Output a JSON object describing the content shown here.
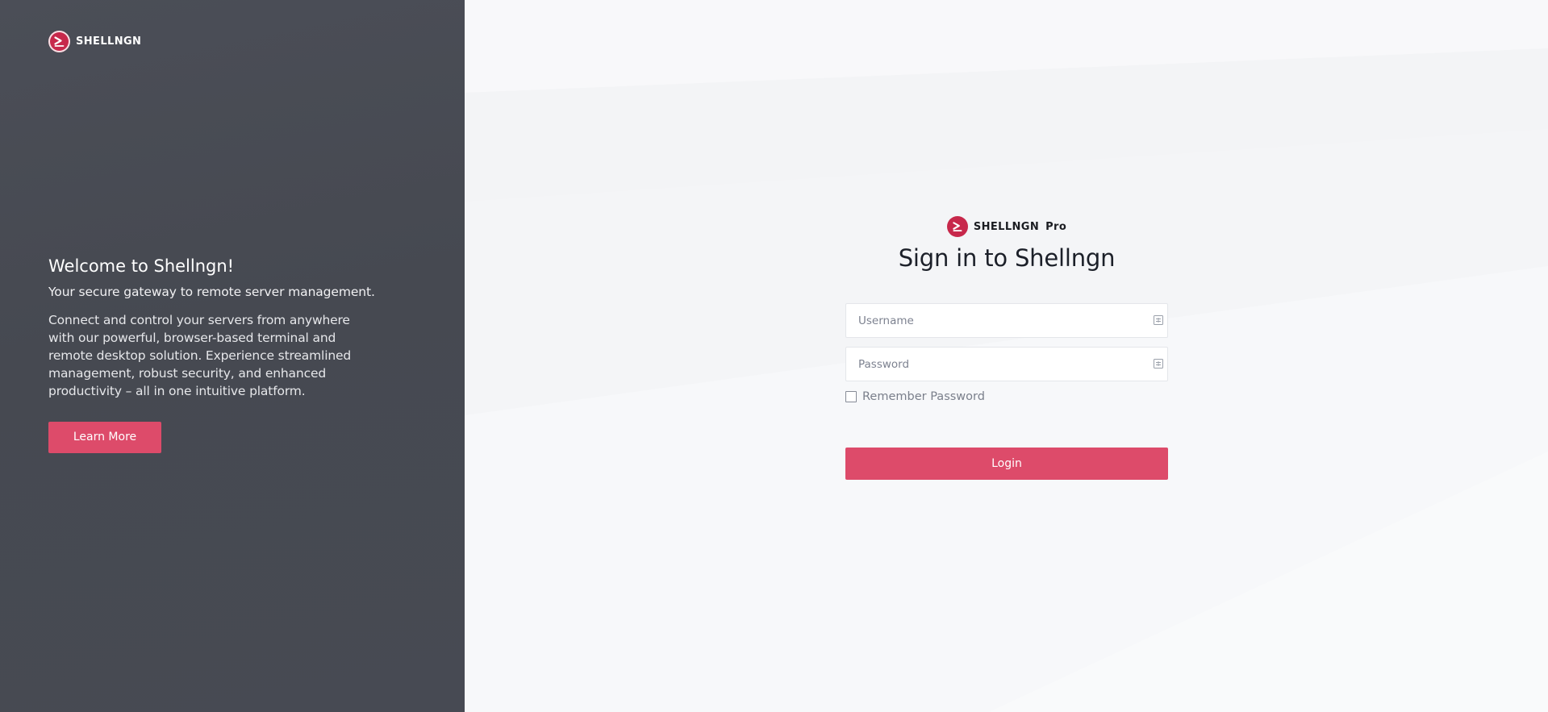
{
  "brand": {
    "name_light": "SHELL",
    "name_heavy": "NGN",
    "edition": "Pro"
  },
  "intro": {
    "title": "Welcome to Shellngn!",
    "tagline": "Your secure gateway to remote server management.",
    "description": "Connect and control your servers from anywhere with our powerful, browser-based terminal and remote desktop solution. Experience streamlined management, robust security, and enhanced productivity – all in one intuitive platform.",
    "learn_more_label": "Learn More"
  },
  "login": {
    "title": "Sign in to Shellngn",
    "username_placeholder": "Username",
    "password_placeholder": "Password",
    "remember_label": "Remember Password",
    "remember_checked": false,
    "submit_label": "Login"
  },
  "colors": {
    "accent": "#dd4b6a",
    "logo": "#c7284b",
    "left_panel": "#474a53",
    "right_panel": "#f5f6f8"
  },
  "icons": {
    "logo": "shellngn-logo-icon",
    "username_field": "keyboard-icon",
    "password_field": "keyboard-icon"
  }
}
